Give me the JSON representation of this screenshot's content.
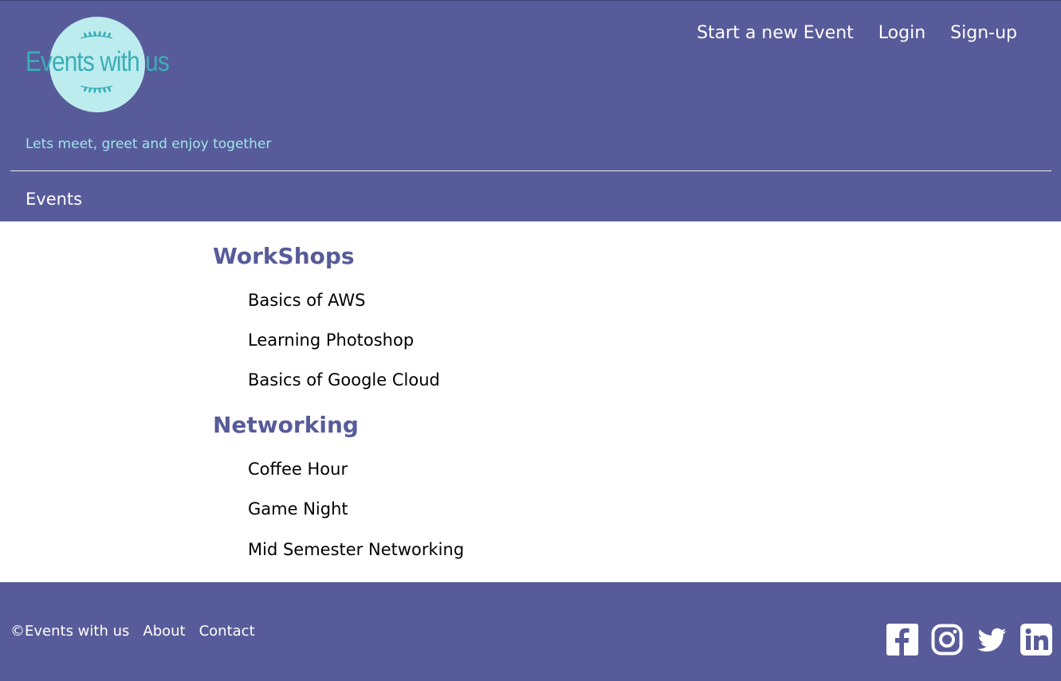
{
  "brand": {
    "logo_text": "Events with us",
    "tagline": "Lets meet, greet and enjoy together"
  },
  "top_nav": [
    {
      "label": "Start a new Event"
    },
    {
      "label": "Login"
    },
    {
      "label": "Sign-up"
    }
  ],
  "sub_nav": {
    "events_label": "Events"
  },
  "sections": [
    {
      "title": "WorkShops",
      "items": [
        "Basics of AWS",
        "Learning Photoshop",
        "Basics of Google Cloud"
      ]
    },
    {
      "title": "Networking",
      "items": [
        "Coffee Hour",
        "Game Night",
        "Mid Semester Networking"
      ]
    }
  ],
  "footer": {
    "copyright": "©Events with us",
    "about": "About",
    "contact": "Contact",
    "social": [
      "facebook-icon",
      "instagram-icon",
      "twitter-icon",
      "linkedin-icon"
    ]
  },
  "colors": {
    "header_bg": "#585b99",
    "logo_circle": "#bdecef",
    "logo_text": "#3aaeb6",
    "tagline": "#9ee6ea",
    "section_title": "#585b99"
  }
}
